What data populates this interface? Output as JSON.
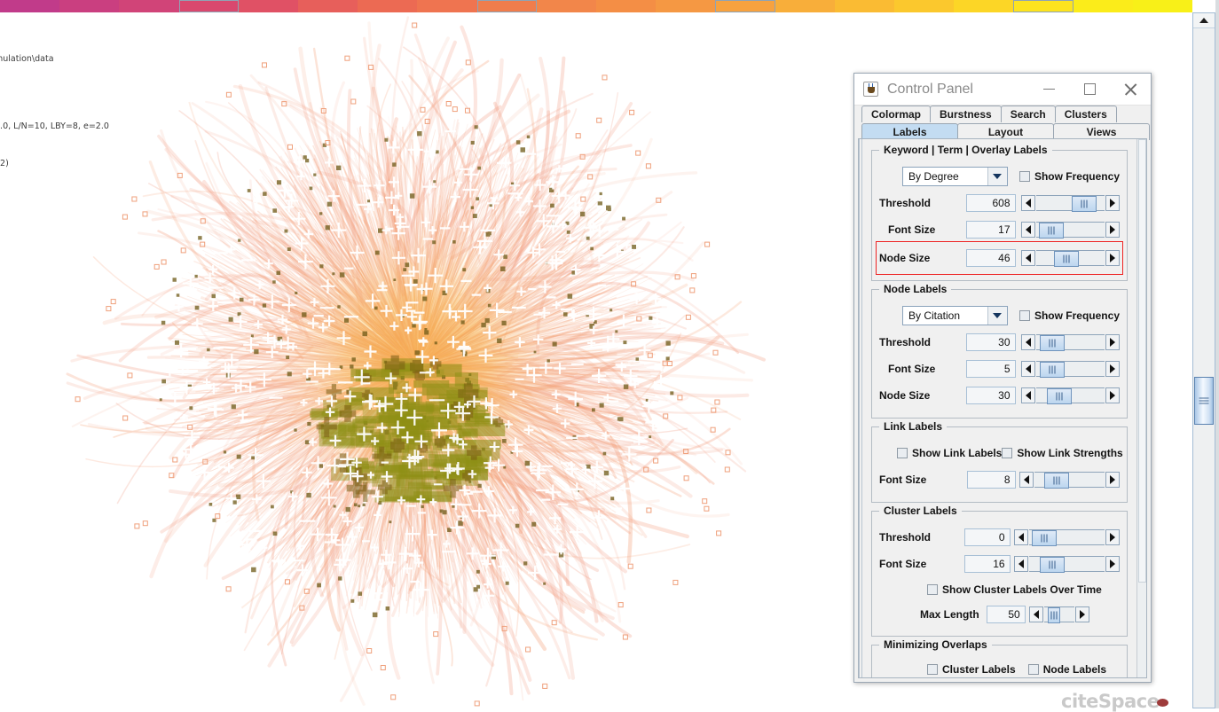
{
  "app": {
    "watermark": "citeSpace"
  },
  "colormap": {
    "segments": [
      {
        "color": "#c13b8a",
        "selected": false
      },
      {
        "color": "#ca3f80",
        "selected": false
      },
      {
        "color": "#d14478",
        "selected": false
      },
      {
        "color": "#d9486e",
        "selected": true
      },
      {
        "color": "#e05165",
        "selected": false
      },
      {
        "color": "#e75f5b",
        "selected": false
      },
      {
        "color": "#ec6a53",
        "selected": false
      },
      {
        "color": "#ef7450",
        "selected": false
      },
      {
        "color": "#f07d4c",
        "selected": true
      },
      {
        "color": "#f2864a",
        "selected": false
      },
      {
        "color": "#f48e45",
        "selected": false
      },
      {
        "color": "#f59843",
        "selected": false
      },
      {
        "color": "#f7a23f",
        "selected": true
      },
      {
        "color": "#f8ae3a",
        "selected": false
      },
      {
        "color": "#fabb33",
        "selected": false
      },
      {
        "color": "#fbc82d",
        "selected": false
      },
      {
        "color": "#fcd626",
        "selected": false
      },
      {
        "color": "#fde31f",
        "selected": true
      },
      {
        "color": "#fbec1a",
        "selected": false
      },
      {
        "color": "#f8f018",
        "selected": false
      }
    ]
  },
  "info": {
    "line1": "mulation\\data",
    "line2": "3.0, L/N=10, LBY=8, e=2.0",
    "line3": "42)"
  },
  "window": {
    "title": "Control Panel",
    "java_icon": "java-coffee-cup-icon",
    "minimize_label": "–",
    "maximize_label": "□",
    "close_label": "✕"
  },
  "tabs_row1": [
    {
      "label": "Colormap",
      "selected": false
    },
    {
      "label": "Burstness",
      "selected": false
    },
    {
      "label": "Search",
      "selected": false
    },
    {
      "label": "Clusters",
      "selected": false
    }
  ],
  "tabs_row2": [
    {
      "label": "Labels",
      "selected": true
    },
    {
      "label": "Layout",
      "selected": false
    },
    {
      "label": "Views",
      "selected": false
    }
  ],
  "keyword_group": {
    "title": "Keyword | Term | Overlay Labels",
    "mode": "By Degree",
    "show_frequency_label": "Show Frequency",
    "show_frequency_checked": false,
    "rows": [
      {
        "label": "Threshold",
        "value": "608",
        "thumb_pct": 52
      },
      {
        "label": "Font Size",
        "value": "17",
        "thumb_pct": 8
      },
      {
        "label": "Node Size",
        "value": "46",
        "thumb_pct": 28
      }
    ]
  },
  "node_labels_group": {
    "title": "Node Labels",
    "mode": "By Citation",
    "show_frequency_label": "Show Frequency",
    "show_frequency_checked": false,
    "rows": [
      {
        "label": "Threshold",
        "value": "30",
        "thumb_pct": 10
      },
      {
        "label": "Font Size",
        "value": "5",
        "thumb_pct": 10
      },
      {
        "label": "Node Size",
        "value": "30",
        "thumb_pct": 20
      }
    ]
  },
  "link_labels_group": {
    "title": "Link Labels",
    "show_link_labels_label": "Show Link Labels",
    "show_link_labels_checked": false,
    "show_link_strengths_label": "Show Link Strengths",
    "show_link_strengths_checked": false,
    "font_size_label": "Font Size",
    "font_size_value": "8",
    "font_size_thumb_pct": 18
  },
  "cluster_labels_group": {
    "title": "Cluster Labels",
    "threshold_label": "Threshold",
    "threshold_value": "0",
    "threshold_thumb_pct": 9,
    "font_size_label": "Font Size",
    "font_size_value": "16",
    "font_size_thumb_pct": 20,
    "over_time_label": "Show Cluster Labels Over Time",
    "over_time_checked": false,
    "max_length_label": "Max Length",
    "max_length_value": "50",
    "max_length_thumb_pct": 28
  },
  "minimizing_overlaps_group": {
    "title": "Minimizing Overlaps",
    "cluster_labels_label": "Cluster Labels",
    "cluster_labels_checked": false,
    "node_labels_label": "Node Labels",
    "node_labels_checked": false
  },
  "chart_data": {
    "type": "scatter",
    "title": "CiteSpace co-citation network",
    "description": "Radial hairball network: dense orange/yellow core with olive-green high-citation node clusters at centre, pale salmon long curved links radiating outward",
    "node_count_approx": 900,
    "link_color_range": [
      "#f6c6b4",
      "#f5a65e",
      "#fad23a",
      "#f28b6a"
    ],
    "core_node_color": "#8a8c12",
    "label_marker_color": "#ffffff"
  }
}
